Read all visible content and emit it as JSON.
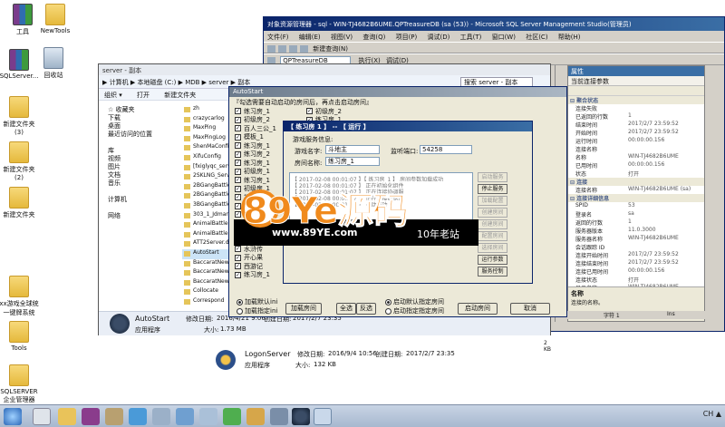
{
  "desktop": {
    "icons": [
      {
        "label": "工具",
        "kind": "winrar"
      },
      {
        "label": "NewTools",
        "kind": "folder"
      },
      {
        "label": "SQLServer...",
        "kind": "winrar"
      },
      {
        "label": "回收站",
        "kind": "bin"
      },
      {
        "label": "新建文件夹 (3)",
        "kind": "folder"
      },
      {
        "label": "新建文件夹 (2)",
        "kind": "folder"
      },
      {
        "label": "新建文件夹",
        "kind": "folder"
      },
      {
        "label": "xx游戏全球统一键牌系统",
        "kind": "folder"
      },
      {
        "label": "Tools",
        "kind": "folder"
      },
      {
        "label": "SQLSERVER企业管理器",
        "kind": "folder"
      }
    ]
  },
  "ssms": {
    "title": "对象资源管理器 - sql - WIN-TJ4682B6UME.QPTreasureDB (sa (53)) - Microsoft SQL Server Management Studio(管理员)",
    "menu": [
      "文件(F)",
      "编辑(E)",
      "视图(V)",
      "查询(Q)",
      "项目(P)",
      "调试(D)",
      "工具(T)",
      "窗口(W)",
      "社区(C)",
      "帮助(H)"
    ],
    "new_query": "新建查询(N)",
    "database": "QPTreasureDB",
    "execute": "执行(X)",
    "debug": "调试(D)"
  },
  "properties": {
    "title": "属性",
    "header": "当前连接参数",
    "sections": [
      {
        "name": "聚合状态",
        "rows": [
          [
            "连接失败",
            ""
          ],
          [
            "已返回的行数",
            "1"
          ],
          [
            "结束时间",
            "2017/2/7 23:59:52"
          ],
          [
            "开始时间",
            "2017/2/7 23:59:52"
          ],
          [
            "运行时间",
            "00:00:00.156"
          ],
          [
            "连接名称",
            ""
          ],
          [
            "名称",
            "WIN-TJ4682B6UME"
          ],
          [
            "已用时间",
            "00:00:00.156"
          ],
          [
            "状态",
            "打开"
          ]
        ]
      },
      {
        "name": "连接",
        "rows": [
          [
            "连接名称",
            "WIN-TJ4682B6UME (sa)"
          ]
        ]
      },
      {
        "name": "连接详细信息",
        "rows": [
          [
            "SPID",
            "53"
          ],
          [
            "登录名",
            "sa"
          ],
          [
            "返回的行数",
            "1"
          ],
          [
            "服务器版本",
            "11.0.3000"
          ],
          [
            "服务器名称",
            "WIN-TJ4682B6UME"
          ],
          [
            "会话跟踪 ID",
            ""
          ],
          [
            "连接开始时间",
            "2017/2/7 23:59:52"
          ],
          [
            "连接结束时间",
            "2017/2/7 23:59:52"
          ],
          [
            "连接已用时间",
            "00:00:00.156"
          ],
          [
            "连接状态",
            "打开"
          ],
          [
            "显示名称",
            "WIN-TJ4682B6UME"
          ]
        ]
      }
    ],
    "desc_title": "名称",
    "desc_text": "连接的名称。",
    "status_col": "字符 1",
    "status_ins": "Ins"
  },
  "explorer": {
    "title": "server - 副本",
    "breadcrumb": "▶ 计算机 ▶ 本地磁盘 (C:) ▶ MDB ▶ server ▶ 副本",
    "search_placeholder": "搜索 server - 副本",
    "toolbar": [
      "组织 ▾",
      "打开",
      "新建文件夹"
    ],
    "nav": [
      "☆ 收藏夹",
      "下载",
      "桌面",
      "最近访问的位置",
      "",
      "库",
      "视频",
      "图片",
      "文档",
      "音乐",
      "",
      "计算机",
      "",
      "网络"
    ],
    "files": [
      "zh",
      "crazycarlog",
      "MaxPing",
      "MaxPingLog",
      "ShenMaConfig",
      "XifuConfig",
      "[fxiglyqc_server]",
      "2SKLNG_Server...",
      "2BGangBattle...",
      "2BGangBattle...",
      "3BGangBattle...",
      "303_1_Jdmanie...",
      "AnimalBattle...",
      "AnimalBattle...",
      "ATT2Server.dll",
      "AutoStart",
      "BaccaratNewAcc...",
      "BaccaratNewCar...",
      "BaccaratNewCar...",
      "Collocate",
      "Correspond"
    ],
    "details": {
      "name": "AutoStart",
      "modified_label": "修改日期:",
      "modified": "2016/4/21 9:06",
      "created_label": "创建日期:",
      "created": "2017/2/7 23:35",
      "type": "应用程序",
      "size_label": "大小:",
      "size": "1.73 MB"
    }
  },
  "logon": {
    "name": "LogonServer",
    "modified_label": "修改日期:",
    "modified": "2016/9/4 10:56",
    "created_label": "创建日期:",
    "created": "2017/2/7 23:35",
    "type": "应用程序",
    "size_label": "大小:",
    "size": "132 KB",
    "extra": "2 KB"
  },
  "autostart": {
    "title": "AutoStart",
    "hint": "『勾选需要自动启动的房间后，再点击启动房间』",
    "rooms_col1": [
      [
        "练习房_1",
        true
      ],
      [
        "初级房_2",
        true
      ],
      [
        "百人三公_1",
        true
      ],
      [
        "模板_1",
        true
      ],
      [
        "练习房_1",
        true
      ],
      [
        "练习房_2",
        true
      ],
      [
        "练习房_1",
        true
      ],
      [
        "初级房_1",
        true
      ],
      [
        "练习房_1",
        true
      ],
      [
        "初级房_1",
        true
      ],
      [
        "初级房_1",
        true
      ],
      [
        "初级房_1",
        true
      ],
      [
        "初级房_1",
        true
      ],
      [
        "初级房_1",
        true
      ],
      [
        "飞禽走兽",
        true
      ],
      [
        "红蚂蚁街机_1",
        true
      ],
      [
        "水浒传",
        true
      ],
      [
        "开心果",
        true
      ],
      [
        "西游记",
        true
      ],
      [
        "练习房_1",
        true
      ]
    ],
    "rooms_col2": [
      [
        "初级房_2",
        true
      ],
      [
        "练习房_1",
        true
      ],
      [
        "初级房_2",
        true
      ]
    ],
    "radio_default": "加载默认ini",
    "radio_custom": "加载指定ini",
    "btn_load_rooms": "加载房间",
    "btn_select_all": "全选",
    "btn_invert": "反选",
    "radio_start_default": "启动默认指定房间",
    "radio_start_custom": "启动指定指定房间",
    "btn_start_rooms": "启动房间",
    "btn_cancel": "取消"
  },
  "run_dialog": {
    "title": "【 练习房 1 】 -- 【 运行 】",
    "group": "游戏服务信息:",
    "game_name_label": "游戏名字:",
    "game_name": "斗地主",
    "port_label": "监听端口:",
    "port": "54258",
    "room_label": "房间名称:",
    "room": "练习房_1",
    "log": [
      "【 2017-02-08 00:01:07 】【 练习房_1 】 房间参数加载成功",
      "【 2017-02-08 00:01:07 】 正在初始化组件",
      "【 2017-02-08 00:01:07 】 正在连接协调服",
      "【 2017-02-08 00:01:07 】 正在连接数据库",
      "【 2017-02-08 00:01:07 】 启动成功"
    ],
    "buttons": [
      [
        "启动服务",
        false
      ],
      [
        "停止服务",
        true
      ],
      [
        "加载配置",
        false
      ],
      [
        "创建房间",
        false
      ],
      [
        "创建房间",
        false
      ],
      [
        "配置房间",
        false
      ],
      [
        "选择房间",
        false
      ],
      [
        "运行参数",
        true
      ],
      [
        "服务控制",
        true
      ]
    ]
  },
  "watermark": {
    "brand": "89Ye源码",
    "url": "www.89YE.com",
    "tag": "10年老站"
  },
  "taskbar": {
    "tray_text": "CH"
  }
}
